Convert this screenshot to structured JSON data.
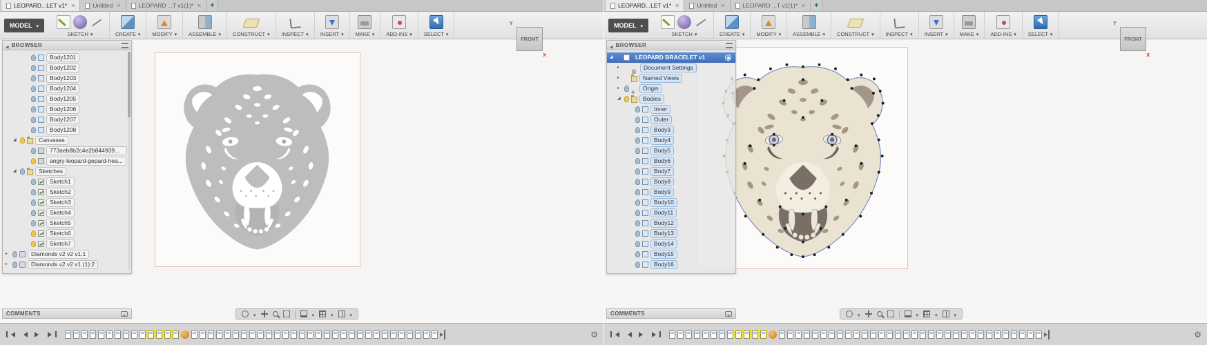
{
  "new_tab": "+",
  "tabs": [
    {
      "label": "LEOPARD...LET v1*",
      "state": "active",
      "close": "×"
    },
    {
      "label": "Untitled",
      "state": "",
      "close": "×"
    },
    {
      "label": "LEOPARD ...T v1(1)*",
      "state": "",
      "close": "×"
    }
  ],
  "toolbar": {
    "workspace": "MODEL",
    "groups": [
      {
        "label": "SKETCH"
      },
      {
        "label": "CREATE"
      },
      {
        "label": "MODIFY"
      },
      {
        "label": "ASSEMBLE"
      },
      {
        "label": "CONSTRUCT"
      },
      {
        "label": "INSPECT"
      },
      {
        "label": "INSERT"
      },
      {
        "label": "MAKE"
      },
      {
        "label": "ADD-INS"
      },
      {
        "label": "SELECT"
      }
    ]
  },
  "viewcube": {
    "front": "FRONT",
    "axis_x": "X",
    "axis_y": "Y"
  },
  "browser_title": "BROWSER",
  "comments_title": "COMMENTS",
  "windows": [
    {
      "side": "left",
      "browser_items": [
        {
          "label": "Body1201",
          "type": "body",
          "ind": "ind2",
          "exp": "",
          "bulb": "off"
        },
        {
          "label": "Body1202",
          "type": "body",
          "ind": "ind2",
          "exp": "",
          "bulb": "off"
        },
        {
          "label": "Body1203",
          "type": "body",
          "ind": "ind2",
          "exp": "",
          "bulb": "off"
        },
        {
          "label": "Body1204",
          "type": "body",
          "ind": "ind2",
          "exp": "",
          "bulb": "off"
        },
        {
          "label": "Body1205",
          "type": "body",
          "ind": "ind2",
          "exp": "",
          "bulb": "off"
        },
        {
          "label": "Body1206",
          "type": "body",
          "ind": "ind2",
          "exp": "",
          "bulb": "off"
        },
        {
          "label": "Body1207",
          "type": "body",
          "ind": "ind2",
          "exp": "",
          "bulb": "off"
        },
        {
          "label": "Body1208",
          "type": "body",
          "ind": "ind2",
          "exp": "",
          "bulb": "off"
        },
        {
          "label": "Canvases",
          "type": "folder",
          "ind": "ind1",
          "exp": "open",
          "bulb": "on"
        },
        {
          "label": "773aeb8b2c4e2b84493984...",
          "type": "canvas",
          "ind": "ind2",
          "exp": "",
          "bulb": "off"
        },
        {
          "label": "angry-leopard-gepard-hea...",
          "type": "canvas",
          "ind": "ind2",
          "exp": "",
          "bulb": "on"
        },
        {
          "label": "Sketches",
          "type": "folder",
          "ind": "ind1",
          "exp": "open",
          "bulb": "off"
        },
        {
          "label": "Sketch1",
          "type": "sketch",
          "ind": "ind2",
          "exp": "",
          "bulb": "off"
        },
        {
          "label": "Sketch2",
          "type": "sketch",
          "ind": "ind2",
          "exp": "",
          "bulb": "off"
        },
        {
          "label": "Sketch3",
          "type": "sketch",
          "ind": "ind2",
          "exp": "",
          "bulb": "off"
        },
        {
          "label": "Sketch4",
          "type": "sketch",
          "ind": "ind2",
          "exp": "",
          "bulb": "off"
        },
        {
          "label": "Sketch5",
          "type": "sketch",
          "ind": "ind2",
          "exp": "",
          "bulb": "off"
        },
        {
          "label": "Sketch6",
          "type": "sketch",
          "ind": "ind2",
          "exp": "",
          "bulb": "on"
        },
        {
          "label": "Sketch7",
          "type": "sketch",
          "ind": "ind2",
          "exp": "",
          "bulb": "on"
        },
        {
          "label": "Diamonds v2 v2 v1:1",
          "type": "comp",
          "ind": "ind0",
          "exp": "closed",
          "bulb": "off"
        },
        {
          "label": "Diamonds v2 v2 v1 (1):2",
          "type": "comp",
          "ind": "ind0",
          "exp": "closed",
          "bulb": "off"
        }
      ],
      "timeline": [
        "s",
        "s",
        "s",
        "s",
        "s",
        "s",
        "s",
        "s",
        "s",
        "s",
        "y",
        "y",
        "y",
        "y",
        "o",
        "s",
        "s",
        "s",
        "s",
        "s",
        "s",
        "s",
        "s",
        "s",
        "s",
        "s",
        "s",
        "s",
        "s",
        "s",
        "s",
        "s",
        "s",
        "s",
        "s",
        "s",
        "s",
        "s",
        "s",
        "s",
        "s",
        "s",
        "s",
        "s",
        "s",
        "m"
      ]
    },
    {
      "side": "right",
      "browser_items": [
        {
          "label": "LEOPARD BRACELET v1",
          "type": "doc",
          "ind": "ind0",
          "exp": "open",
          "bulb": "none"
        },
        {
          "label": "Document Settings",
          "type": "gear",
          "ind": "ind1",
          "exp": "closed",
          "bulb": "none"
        },
        {
          "label": "Named Views",
          "type": "views",
          "ind": "ind1",
          "exp": "closed",
          "bulb": "none"
        },
        {
          "label": "Origin",
          "type": "origin",
          "ind": "ind1",
          "exp": "closed",
          "bulb": "off"
        },
        {
          "label": "Bodies",
          "type": "folder",
          "ind": "ind1",
          "exp": "open",
          "bulb": "on"
        },
        {
          "label": "Inner",
          "type": "body",
          "ind": "ind2",
          "exp": "",
          "bulb": "off"
        },
        {
          "label": "Outer",
          "type": "body",
          "ind": "ind2",
          "exp": "",
          "bulb": "off"
        },
        {
          "label": "Body3",
          "type": "body",
          "ind": "ind2",
          "exp": "",
          "bulb": "off"
        },
        {
          "label": "Body4",
          "type": "body",
          "ind": "ind2",
          "exp": "",
          "bulb": "off"
        },
        {
          "label": "Body5",
          "type": "body",
          "ind": "ind2",
          "exp": "",
          "bulb": "off"
        },
        {
          "label": "Body6",
          "type": "body",
          "ind": "ind2",
          "exp": "",
          "bulb": "off"
        },
        {
          "label": "Body7",
          "type": "body",
          "ind": "ind2",
          "exp": "",
          "bulb": "off"
        },
        {
          "label": "Body8",
          "type": "body",
          "ind": "ind2",
          "exp": "",
          "bulb": "off"
        },
        {
          "label": "Body9",
          "type": "body",
          "ind": "ind2",
          "exp": "",
          "bulb": "off"
        },
        {
          "label": "Body10",
          "type": "body",
          "ind": "ind2",
          "exp": "",
          "bulb": "off"
        },
        {
          "label": "Body11",
          "type": "body",
          "ind": "ind2",
          "exp": "",
          "bulb": "off"
        },
        {
          "label": "Body12",
          "type": "body",
          "ind": "ind2",
          "exp": "",
          "bulb": "off"
        },
        {
          "label": "Body13",
          "type": "body",
          "ind": "ind2",
          "exp": "",
          "bulb": "off"
        },
        {
          "label": "Body14",
          "type": "body",
          "ind": "ind2",
          "exp": "",
          "bulb": "off"
        },
        {
          "label": "Body15",
          "type": "body",
          "ind": "ind2",
          "exp": "",
          "bulb": "off"
        },
        {
          "label": "Body16",
          "type": "body",
          "ind": "ind2",
          "exp": "",
          "bulb": "off"
        }
      ],
      "timeline": [
        "s",
        "s",
        "s",
        "s",
        "s",
        "s",
        "s",
        "s",
        "y",
        "y",
        "y",
        "y",
        "o",
        "s",
        "s",
        "s",
        "s",
        "s",
        "s",
        "s",
        "s",
        "s",
        "s",
        "s",
        "s",
        "s",
        "s",
        "s",
        "s",
        "s",
        "s",
        "s",
        "s",
        "s",
        "s",
        "s",
        "s",
        "s",
        "s",
        "s",
        "s",
        "s",
        "s",
        "s",
        "s",
        "m"
      ]
    }
  ]
}
